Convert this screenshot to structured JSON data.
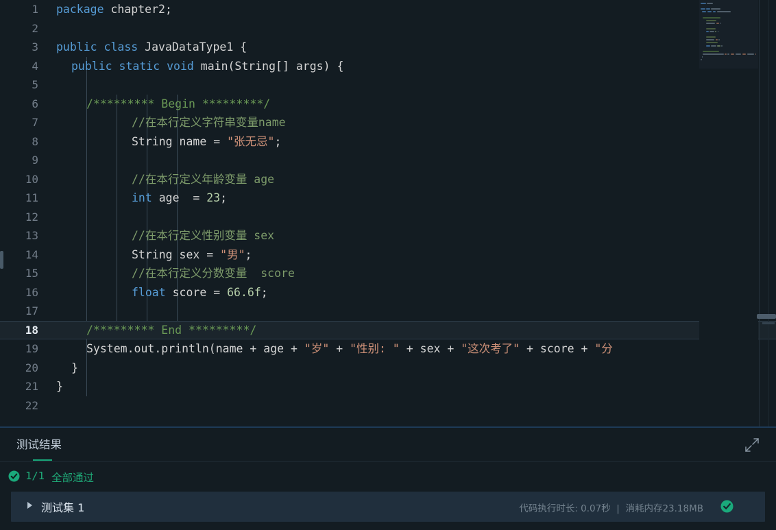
{
  "editor": {
    "font_size": "16.5px",
    "line_height": 27.5,
    "active_line": 18,
    "background": "#131c22",
    "colors": {
      "keyword": "#569cd6",
      "string": "#ce9178",
      "number": "#b5cea8",
      "comment": "#6a9955",
      "plain": "#d4d4d4",
      "line_number": "#737e8a",
      "active_line_number": "#e8eef4",
      "indent_guide": "#3b4b58"
    },
    "line_numbers": [
      1,
      2,
      3,
      4,
      5,
      6,
      7,
      8,
      9,
      10,
      11,
      12,
      13,
      14,
      15,
      16,
      17,
      18,
      19,
      20,
      21,
      22
    ],
    "lines": [
      {
        "n": 1,
        "indent": 0,
        "tokens": [
          {
            "t": "package ",
            "c": "kw"
          },
          {
            "t": "chapter2;",
            "c": "pln"
          }
        ]
      },
      {
        "n": 2,
        "indent": 0,
        "tokens": []
      },
      {
        "n": 3,
        "indent": 0,
        "tokens": [
          {
            "t": "public ",
            "c": "kw"
          },
          {
            "t": "class ",
            "c": "kw"
          },
          {
            "t": "JavaDataType1 {",
            "c": "pln"
          }
        ]
      },
      {
        "n": 4,
        "indent": 1,
        "tokens": [
          {
            "t": "public ",
            "c": "kw"
          },
          {
            "t": "static ",
            "c": "kw"
          },
          {
            "t": "void ",
            "c": "kw"
          },
          {
            "t": "main(String[] args) {",
            "c": "pln"
          }
        ]
      },
      {
        "n": 5,
        "indent": 0,
        "tokens": []
      },
      {
        "n": 6,
        "indent": 2,
        "tokens": [
          {
            "t": "/********* Begin *********/",
            "c": "cmt"
          }
        ]
      },
      {
        "n": 7,
        "indent": 5,
        "tokens": [
          {
            "t": "//在本行定义字符串变量name",
            "c": "cmt2"
          }
        ]
      },
      {
        "n": 8,
        "indent": 5,
        "tokens": [
          {
            "t": "String name = ",
            "c": "pln"
          },
          {
            "t": "\"张无忌\"",
            "c": "str"
          },
          {
            "t": ";",
            "c": "pln"
          }
        ]
      },
      {
        "n": 9,
        "indent": 0,
        "tokens": []
      },
      {
        "n": 10,
        "indent": 5,
        "tokens": [
          {
            "t": "//在本行定义年龄变量 age",
            "c": "cmt2"
          }
        ]
      },
      {
        "n": 11,
        "indent": 5,
        "tokens": [
          {
            "t": "int ",
            "c": "kw"
          },
          {
            "t": "age  = ",
            "c": "pln"
          },
          {
            "t": "23",
            "c": "num"
          },
          {
            "t": ";",
            "c": "pln"
          }
        ]
      },
      {
        "n": 12,
        "indent": 0,
        "tokens": []
      },
      {
        "n": 13,
        "indent": 5,
        "tokens": [
          {
            "t": "//在本行定义性别变量 sex",
            "c": "cmt2"
          }
        ]
      },
      {
        "n": 14,
        "indent": 5,
        "tokens": [
          {
            "t": "String sex = ",
            "c": "pln"
          },
          {
            "t": "\"男\"",
            "c": "str"
          },
          {
            "t": ";",
            "c": "pln"
          }
        ]
      },
      {
        "n": 15,
        "indent": 5,
        "tokens": [
          {
            "t": "//在本行定义分数变量  score",
            "c": "cmt2"
          }
        ]
      },
      {
        "n": 16,
        "indent": 5,
        "tokens": [
          {
            "t": "float ",
            "c": "kw"
          },
          {
            "t": "score = ",
            "c": "pln"
          },
          {
            "t": "66.6f",
            "c": "num"
          },
          {
            "t": ";",
            "c": "pln"
          }
        ]
      },
      {
        "n": 17,
        "indent": 0,
        "tokens": []
      },
      {
        "n": 18,
        "indent": 2,
        "active": true,
        "tokens": [
          {
            "t": "/********* End *********/",
            "c": "cmt"
          }
        ]
      },
      {
        "n": 19,
        "indent": 2,
        "tokens": [
          {
            "t": "System.out.println(name + age + ",
            "c": "pln"
          },
          {
            "t": "\"岁\"",
            "c": "str"
          },
          {
            "t": " + ",
            "c": "pln"
          },
          {
            "t": "\"性别: \"",
            "c": "str"
          },
          {
            "t": " + sex + ",
            "c": "pln"
          },
          {
            "t": "\"这次考了\"",
            "c": "str"
          },
          {
            "t": " + score + ",
            "c": "pln"
          },
          {
            "t": "\"分",
            "c": "str"
          }
        ]
      },
      {
        "n": 20,
        "indent": 1,
        "tokens": [
          {
            "t": "}",
            "c": "pln"
          }
        ]
      },
      {
        "n": 21,
        "indent": 0,
        "tokens": [
          {
            "t": "}",
            "c": "pln"
          }
        ]
      },
      {
        "n": 22,
        "indent": 0,
        "tokens": []
      }
    ],
    "indent_guides_x": [
      126,
      170,
      214,
      258
    ],
    "minimap": {
      "label": "code-minimap"
    },
    "scrollbar": {
      "label": "horizontal-scrollbar"
    }
  },
  "panel": {
    "tab_label": "测试结果",
    "expand_icon": "expand-diagonal-icon",
    "accent": "#1aa97b",
    "summary": {
      "icon": "check-circle-icon",
      "count": "1/1",
      "text": "全部通过"
    },
    "case": {
      "caret_icon": "caret-right-icon",
      "name": "测试集 1",
      "meta": "代码执行时长: 0.07秒  |  消耗内存23.18MB",
      "status_icon": "check-circle-icon"
    }
  }
}
